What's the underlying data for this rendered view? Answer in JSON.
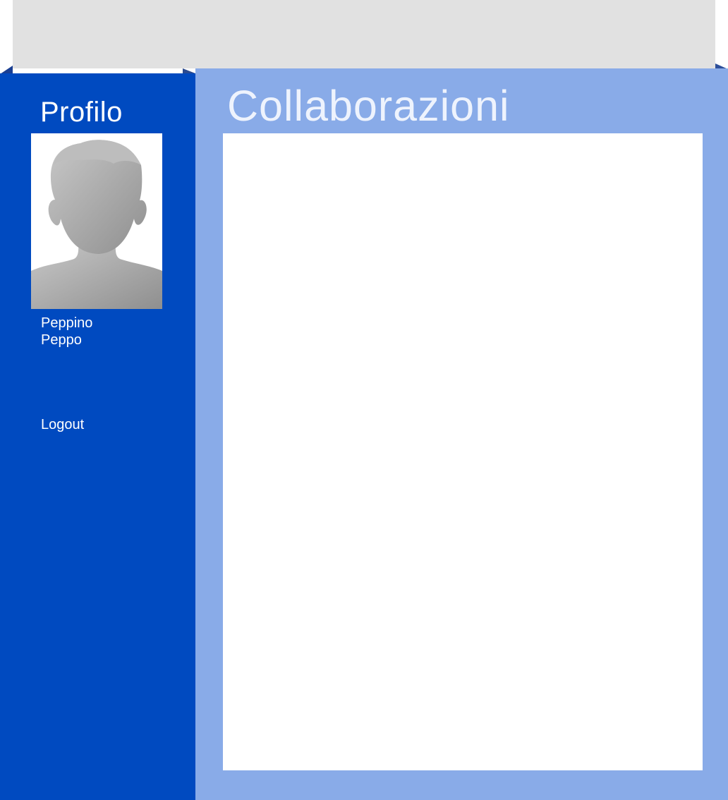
{
  "colors": {
    "top_banner": "#e1e1e1",
    "sidebar_background": "#004ac0",
    "main_background": "#89abe8",
    "content_panel": "#ffffff",
    "sidebar_text": "#ffffff",
    "title_text": "#eef3fd"
  },
  "sidebar": {
    "title": "Profilo",
    "avatar_icon": "default-user-avatar",
    "user_name": {
      "first_name": "Peppino",
      "last_name": "Peppo"
    },
    "logout_label": "Logout"
  },
  "main": {
    "title": "Collaborazioni"
  }
}
